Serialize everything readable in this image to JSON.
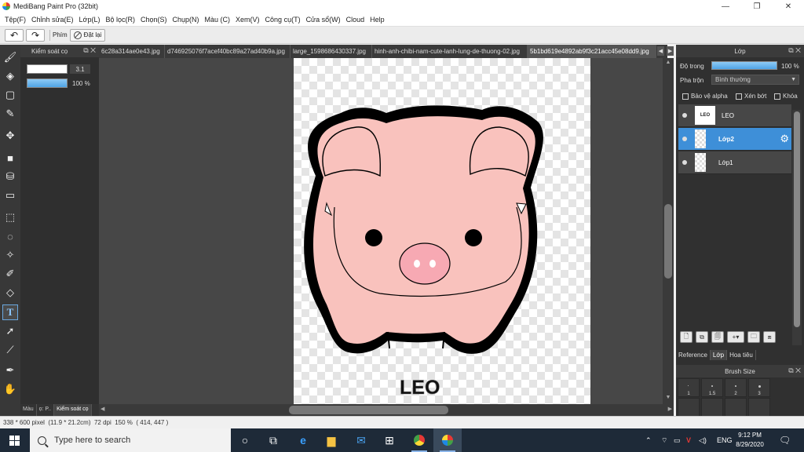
{
  "window": {
    "title": "MediBang Paint Pro (32bit)",
    "controls": {
      "minimize": "—",
      "restore": "❐",
      "close": "✕"
    }
  },
  "menu": [
    "Tệp(F)",
    "Chỉnh sửa(E)",
    "Lớp(L)",
    "Bộ lọc(R)",
    "Chọn(S)",
    "Chụp(N)",
    "Màu (C)",
    "Xem(V)",
    "Công cụ(T)",
    "Cửa sổ(W)",
    "Cloud",
    "Help"
  ],
  "toolbar": {
    "label": "Phím",
    "reset_label": "Đặt lại"
  },
  "left_panel": {
    "title": "Kiểm soát cọ",
    "brush_size": "3.1",
    "brush_opacity": "100 %",
    "tabs": [
      "Màu",
      "ọ: P..",
      "Kiểm soát cọ"
    ]
  },
  "doc_tabs": [
    "6c28a314ae0e43.jpg",
    "d746925076f7acef40bc89a27ad40b9a.jpg",
    "large_1598686430337.jpg",
    "hinh-anh-chibi-nam-cute-lanh-lung-de-thuong-02.jpg",
    "5b1bd619e4892ab9f3c21acc45e08dd9.jpg"
  ],
  "active_tab_index": 4,
  "canvas": {
    "caption": "LEO"
  },
  "layer_panel": {
    "title": "Lớp",
    "opacity_label": "Độ trong",
    "opacity_value": "100 %",
    "blend_label": "Pha trộn",
    "blend_value": "Bình thường",
    "checkbox_alpha": "Bảo vệ alpha",
    "checkbox_clip": "Xén bớt",
    "checkbox_lock": "Khóa",
    "layers": [
      {
        "name": "LEO",
        "thumb_text": "LEO"
      },
      {
        "name": "Lớp2",
        "thumb_text": ""
      },
      {
        "name": "Lớp1",
        "thumb_text": ""
      }
    ],
    "selected_layer": 1,
    "tabs": [
      "Reference",
      "Lớp",
      "Hoa tiêu"
    ],
    "active_tab": "Lớp"
  },
  "brush_size_panel": {
    "title": "Brush Size",
    "sizes": [
      "1",
      "1.5",
      "2",
      "3"
    ]
  },
  "status": {
    "size": "338 * 600 pixel",
    "physical": "(11.9 * 21.2cm)",
    "dpi": "72 dpi",
    "zoom": "150 %",
    "cursor": "( 414, 447 )"
  },
  "taskbar": {
    "search_placeholder": "Type here to search",
    "lang": "ENG",
    "time": "9:12 PM",
    "date": "8/29/2020"
  },
  "colors": {
    "pig_pink": "#f9c2bd",
    "outline": "#000000",
    "accent": "#3e8fd8"
  }
}
